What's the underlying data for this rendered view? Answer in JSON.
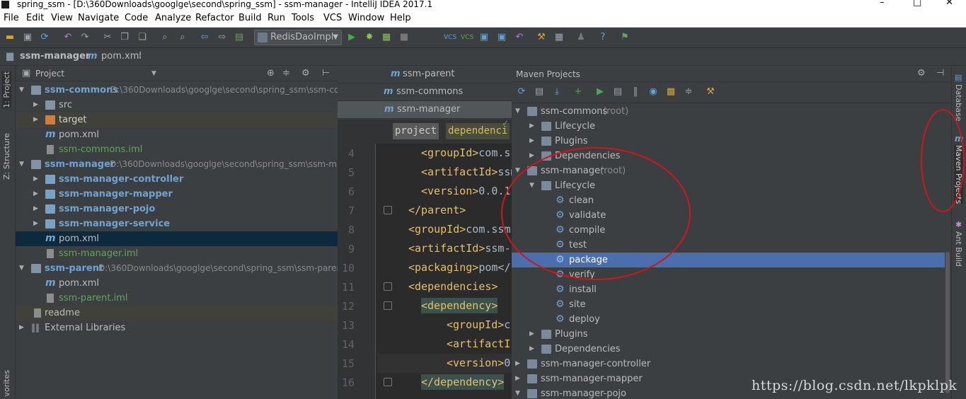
{
  "window": {
    "title": "spring_ssm - [D:\\360Downloads\\googlge\\second\\spring_ssm] - ssm-manager - IntelliJ IDEA 2017.1",
    "controls": [
      "–",
      "□",
      "✕"
    ]
  },
  "menu": [
    "File",
    "Edit",
    "View",
    "Navigate",
    "Code",
    "Analyze",
    "Refactor",
    "Build",
    "Run",
    "Tools",
    "VCS",
    "Window",
    "Help"
  ],
  "toolbar": {
    "run_config": "RedisDaoImpl"
  },
  "navbar": {
    "crumbs": [
      "ssm-manager",
      "pom.xml"
    ]
  },
  "left_tabs": [
    "1: Project",
    "Z: Structure",
    "vorites"
  ],
  "project": {
    "header": "Project",
    "rows": [
      {
        "label": "ssm-commons",
        "kind": "module-root",
        "path": "D:\\360Downloads\\googlge\\second\\spring_ssm\\ssm-co",
        "arrow": "▼"
      },
      {
        "label": "src",
        "kind": "folder",
        "arrow": "▶"
      },
      {
        "label": "target",
        "kind": "folder-orange",
        "arrow": "▶"
      },
      {
        "label": "pom.xml",
        "kind": "maven"
      },
      {
        "label": "ssm-commons.iml",
        "kind": "iml"
      },
      {
        "label": "ssm-manager",
        "kind": "module-root",
        "path": "D:\\360Downloads\\googlge\\second\\spring_ssm\\ssm-ma",
        "arrow": "▼"
      },
      {
        "label": "ssm-manager-controller",
        "kind": "module",
        "arrow": "▶"
      },
      {
        "label": "ssm-manager-mapper",
        "kind": "module",
        "arrow": "▶"
      },
      {
        "label": "ssm-manager-pojo",
        "kind": "module",
        "arrow": "▶"
      },
      {
        "label": "ssm-manager-service",
        "kind": "module",
        "arrow": "▶"
      },
      {
        "label": "pom.xml",
        "kind": "maven"
      },
      {
        "label": "ssm-manager.iml",
        "kind": "iml"
      },
      {
        "label": "ssm-parent",
        "kind": "module-root",
        "path": "D:\\360Downloads\\googlge\\second\\spring_ssm\\ssm-paren",
        "arrow": "▼"
      },
      {
        "label": "pom.xml",
        "kind": "maven"
      },
      {
        "label": "ssm-parent.iml",
        "kind": "iml"
      },
      {
        "label": "readme",
        "kind": "file"
      },
      {
        "label": "External Libraries",
        "kind": "lib",
        "arrow": "▶"
      }
    ]
  },
  "editor": {
    "tabs": [
      "ssm-parent",
      "ssm-commons",
      "ssm-manager"
    ],
    "breadcrumb": [
      "project",
      "dependenci"
    ],
    "line_numbers": [
      "4",
      "5",
      "6",
      "7",
      "8",
      "9",
      "10",
      "11",
      "12",
      "13",
      "14",
      "15",
      "16"
    ],
    "lines": [
      {
        "tag": "<groupId>",
        "text": "com.s"
      },
      {
        "tag": "<artifactId>",
        "text": "ssm"
      },
      {
        "tag": "<version>",
        "text": "0.0.1"
      },
      {
        "tag": "</parent>",
        "text": ""
      },
      {
        "tag": "<groupId>",
        "text": "com.ssm"
      },
      {
        "tag": "<artifactId>",
        "text": "ssm-"
      },
      {
        "tag": "<packaging>",
        "text": "pom</"
      },
      {
        "tag": "<dependencies>",
        "text": ""
      },
      {
        "tag": "<dependency>",
        "text": ""
      },
      {
        "tag": "<groupId>",
        "text": "c"
      },
      {
        "tag": "<artifactI",
        "text": ""
      },
      {
        "tag": "<version>",
        "text": "0"
      },
      {
        "tag": "</dependency>",
        "text": ""
      }
    ]
  },
  "maven": {
    "title": "Maven Projects",
    "rows": [
      {
        "label": "ssm-commons",
        "suffix": "(root)",
        "arrow": "▼",
        "kind": "project"
      },
      {
        "label": "Lifecycle",
        "arrow": "▶",
        "kind": "folder"
      },
      {
        "label": "Plugins",
        "arrow": "▶",
        "kind": "folder"
      },
      {
        "label": "Dependencies",
        "arrow": "▶",
        "kind": "folder"
      },
      {
        "label": "ssm-manager",
        "suffix": "(root)",
        "arrow": "▼",
        "kind": "project"
      },
      {
        "label": "Lifecycle",
        "arrow": "▼",
        "kind": "folder"
      },
      {
        "label": "clean",
        "kind": "goal"
      },
      {
        "label": "validate",
        "kind": "goal"
      },
      {
        "label": "compile",
        "kind": "goal"
      },
      {
        "label": "test",
        "kind": "goal"
      },
      {
        "label": "package",
        "kind": "goal",
        "selected": true
      },
      {
        "label": "verify",
        "kind": "goal"
      },
      {
        "label": "install",
        "kind": "goal"
      },
      {
        "label": "site",
        "kind": "goal"
      },
      {
        "label": "deploy",
        "kind": "goal"
      },
      {
        "label": "Plugins",
        "arrow": "▶",
        "kind": "folder"
      },
      {
        "label": "Dependencies",
        "arrow": "▶",
        "kind": "folder"
      },
      {
        "label": "ssm-manager-controller",
        "arrow": "▶",
        "kind": "project"
      },
      {
        "label": "ssm-manager-mapper",
        "arrow": "▶",
        "kind": "project"
      },
      {
        "label": "ssm-manager-pojo",
        "arrow": "▼",
        "kind": "project"
      }
    ]
  },
  "right_tabs": [
    "Database",
    "Maven Projects",
    "Ant Build"
  ],
  "watermark": "https://blog.csdn.net/lkpklpk",
  "colors": {
    "selection": "#4b6eaf",
    "annotation": "#d0161a",
    "module": "#6fa3d4",
    "iml": "#62a35d"
  }
}
